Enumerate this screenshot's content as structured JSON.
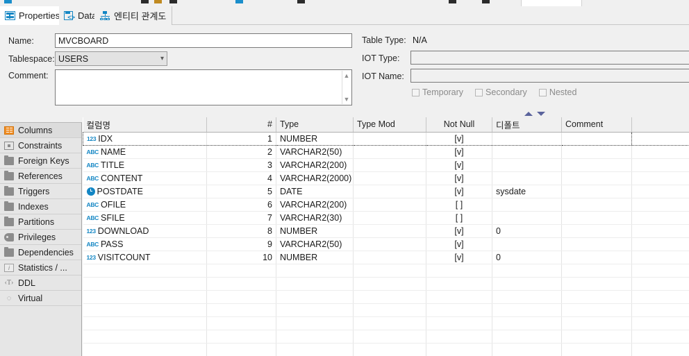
{
  "window": {
    "toolbar_icons": [
      "db-connect-icon",
      "sql-icon",
      "run-icon",
      "commit-icon",
      "window-icon",
      "filter-icon",
      "grid-icon",
      "export-icon"
    ]
  },
  "tabs": [
    {
      "id": "properties",
      "label": "Properties",
      "icon": "properties-table-icon",
      "active": true
    },
    {
      "id": "data",
      "label": "Data",
      "icon": "data-code-icon",
      "active": false
    },
    {
      "id": "erd",
      "label": "엔티티 관계도",
      "icon": "erd-diagram-icon",
      "active": false
    }
  ],
  "properties": {
    "name_label": "Name:",
    "name_value": "MVCBOARD",
    "tablespace_label": "Tablespace:",
    "tablespace_value": "USERS",
    "comment_label": "Comment:",
    "comment_value": "",
    "table_type_label": "Table Type:",
    "table_type_value": "N/A",
    "iot_type_label": "IOT Type:",
    "iot_type_value": "",
    "iot_name_label": "IOT Name:",
    "iot_name_value": "",
    "checkboxes": [
      {
        "label": "Temporary",
        "checked": false
      },
      {
        "label": "Secondary",
        "checked": false
      },
      {
        "label": "Nested",
        "checked": false
      }
    ]
  },
  "sidebar": {
    "items": [
      {
        "label": "Columns",
        "icon": "columns-icon",
        "selected": true
      },
      {
        "label": "Constraints",
        "icon": "constraint-icon",
        "selected": false
      },
      {
        "label": "Foreign Keys",
        "icon": "folder-icon",
        "selected": false
      },
      {
        "label": "References",
        "icon": "folder-icon",
        "selected": false
      },
      {
        "label": "Triggers",
        "icon": "folder-icon",
        "selected": false
      },
      {
        "label": "Indexes",
        "icon": "folder-icon",
        "selected": false
      },
      {
        "label": "Partitions",
        "icon": "folder-icon",
        "selected": false
      },
      {
        "label": "Privileges",
        "icon": "key-icon",
        "selected": false
      },
      {
        "label": "Dependencies",
        "icon": "folder-icon",
        "selected": false
      },
      {
        "label": "Statistics / ...",
        "icon": "info-icon",
        "selected": false
      },
      {
        "label": "DDL",
        "icon": "ddl-text-icon",
        "selected": false
      },
      {
        "label": "Virtual",
        "icon": "virtual-icon",
        "selected": false
      }
    ]
  },
  "grid": {
    "sort_up_icon": "sort-ascending-icon",
    "sort_down_icon": "sort-descending-icon",
    "columns": [
      "컬럼명",
      "#",
      "Type",
      "Type Mod",
      "Not Null",
      "디폴트",
      "Comment"
    ],
    "rows": [
      {
        "type_icon": "number-icon",
        "name": "IDX",
        "num": "1",
        "type": "NUMBER",
        "type_mod": "",
        "not_null": "[v]",
        "default": "",
        "comment": "",
        "selected": true
      },
      {
        "type_icon": "text-icon",
        "name": "NAME",
        "num": "2",
        "type": "VARCHAR2(50)",
        "type_mod": "",
        "not_null": "[v]",
        "default": "",
        "comment": "",
        "selected": false
      },
      {
        "type_icon": "text-icon",
        "name": "TITLE",
        "num": "3",
        "type": "VARCHAR2(200)",
        "type_mod": "",
        "not_null": "[v]",
        "default": "",
        "comment": "",
        "selected": false
      },
      {
        "type_icon": "text-icon",
        "name": "CONTENT",
        "num": "4",
        "type": "VARCHAR2(2000)",
        "type_mod": "",
        "not_null": "[v]",
        "default": "",
        "comment": "",
        "selected": false
      },
      {
        "type_icon": "date-icon",
        "name": "POSTDATE",
        "num": "5",
        "type": "DATE",
        "type_mod": "",
        "not_null": "[v]",
        "default": "sysdate",
        "comment": "",
        "selected": false
      },
      {
        "type_icon": "text-icon",
        "name": "OFILE",
        "num": "6",
        "type": "VARCHAR2(200)",
        "type_mod": "",
        "not_null": "[ ]",
        "default": "",
        "comment": "",
        "selected": false
      },
      {
        "type_icon": "text-icon",
        "name": "SFILE",
        "num": "7",
        "type": "VARCHAR2(30)",
        "type_mod": "",
        "not_null": "[ ]",
        "default": "",
        "comment": "",
        "selected": false
      },
      {
        "type_icon": "number-icon",
        "name": "DOWNLOAD",
        "num": "8",
        "type": "NUMBER",
        "type_mod": "",
        "not_null": "[v]",
        "default": "0",
        "comment": "",
        "selected": false
      },
      {
        "type_icon": "text-icon",
        "name": "PASS",
        "num": "9",
        "type": "VARCHAR2(50)",
        "type_mod": "",
        "not_null": "[v]",
        "default": "",
        "comment": "",
        "selected": false
      },
      {
        "type_icon": "number-icon",
        "name": "VISITCOUNT",
        "num": "10",
        "type": "NUMBER",
        "type_mod": "",
        "not_null": "[v]",
        "default": "0",
        "comment": "",
        "selected": false
      }
    ],
    "type_icon_glyphs": {
      "number-icon": "123",
      "text-icon": "ABC",
      "date-icon": ""
    }
  },
  "colors": {
    "accent_blue": "#1386c4",
    "columns_orange": "#ef8c22",
    "sort_arrow": "#5a639c",
    "panel_bg": "#f0f0f0",
    "sidebar_bg": "#e6e6e6"
  }
}
